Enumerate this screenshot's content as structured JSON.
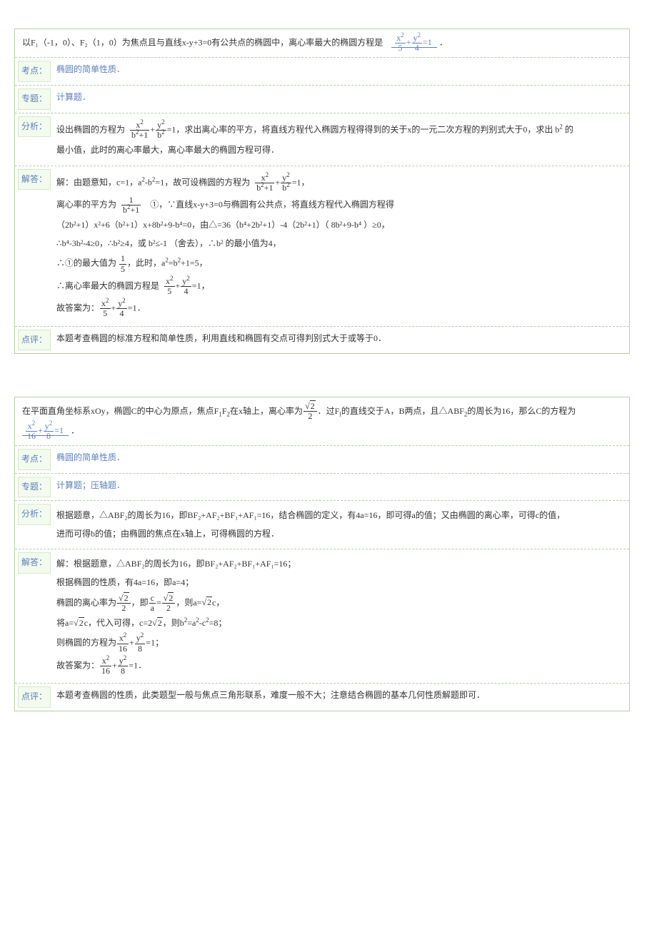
{
  "problems": [
    {
      "question_prefix": "以F₁（-1，0）、F₂（1，0）为焦点且与直线x-y+3=0有公共点的椭圆中，离心率最大的椭圆方程是",
      "answer_blank": "x²/5 + y²/4 = 1",
      "period": "．",
      "rows": {
        "kaodian_label": "考点：",
        "kaodian_text": "椭圆的简单性质．",
        "zhuanti_label": "专题：",
        "zhuanti_text": "计算题．",
        "fenxi_label": "分析：",
        "fenxi_lines": [
          "设出椭圆的方程为  x²/(b²+1) + y²/b² = 1，求出离心率的平方，将直线方程代入椭圆方程得得到的关于x的一元二次方程的判别式大于0，求出 b² 的",
          "最小值，此时的离心率最大，离心率最大的椭圆方程可得．"
        ],
        "jieda_label": "解答：",
        "jieda_lines": [
          "解：由题意知，c=1，a²-b²=1，故可设椭圆的方程为  x²/(b²+1) + y²/b² = 1，",
          "离心率的平方为  1/(b²+1)     ①，∵直线x-y+3=0与椭圆有公共点，将直线方程代入椭圆方程得",
          "（2b²+1）x²+6（b²+1）x+8b²+9-b⁴=0，由△=36（b⁴+2b²+1）-4（2b²+1）（ 8b²+9-b⁴ ）≥0，",
          "∴b⁴-3b²-4≥0，∴b²≥4，或 b²≤-1 （舍去），∴b² 的最小值为4，",
          "∴①的最大值为 1/5，此时，a²=b²+1=5，",
          "∴离心率最大的椭圆方程是  x²/5 + y²/4 = 1，",
          "故答案为：x²/5 + y²/4 = 1．"
        ],
        "dianping_label": "点评：",
        "dianping_text": "本题考查椭圆的标准方程和简单性质，利用直线和椭圆有交点可得判别式大于或等于0．"
      }
    },
    {
      "question_prefix": "在平面直角坐标系xOy，椭圆C的中心为原点，焦点F₁F₂在x轴上，离心率为√2/2．过F₁的直线交于A，B两点，且△ABF₂的周长为16，那么C的方程为",
      "answer_blank": "x²/16 + y²/8 = 1",
      "period": "．",
      "rows": {
        "kaodian_label": "考点：",
        "kaodian_text": "椭圆的简单性质．",
        "zhuanti_label": "专题：",
        "zhuanti_text": "计算题；压轴题．",
        "fenxi_label": "分析：",
        "fenxi_lines": [
          "根据题意，△ABF₂的周长为16，即BF₂+AF₂+BF₁+AF₁=16，结合椭圆的定义，有4a=16，即可得a的值；又由椭圆的离心率，可得c的值，",
          "进而可得b的值；由椭圆的焦点在x轴上，可得椭圆的方程．"
        ],
        "jieda_label": "解答：",
        "jieda_lines": [
          "解：根据题意，△ABF₂的周长为16，即BF₂+AF₂+BF₁+AF₁=16；",
          "根据椭圆的性质，有4a=16，即a=4；",
          "椭圆的离心率为 √2/2，即 c/a = √2/2，则a=√2c，",
          "将a=√2c，代入可得，c=2√2，则b²=a²-c²=8；",
          "则椭圆的方程为 x²/16 + y²/8 = 1；",
          "故答案为：x²/16 + y²/8 = 1．"
        ],
        "dianping_label": "点评：",
        "dianping_text": "本题考查椭圆的性质，此类题型一般与焦点三角形联系，难度一般不大；注意结合椭圆的基本几何性质解题即可．"
      }
    }
  ]
}
